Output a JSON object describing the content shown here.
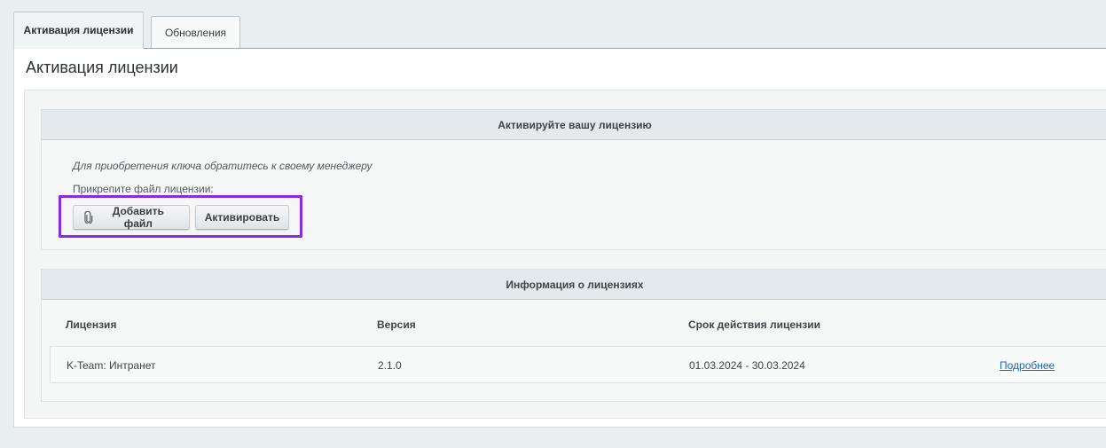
{
  "tabs": [
    {
      "label": "Активация лицензии",
      "active": true
    },
    {
      "label": "Обновления",
      "active": false
    }
  ],
  "page_title": "Активация лицензии",
  "activate_section": {
    "title": "Активируйте вашу лицензию",
    "hint": "Для приобретения ключа обратитесь к своему менеджеру",
    "attach_label": "Прикрепите файл лицензии:",
    "add_file_button": "Добавить файл",
    "activate_button": "Активировать",
    "highlight_color": "#8a2be2"
  },
  "license_section": {
    "title": "Информация о лицензиях",
    "columns": [
      "Лицензия",
      "Версия",
      "Срок действия лицензии"
    ],
    "rows": [
      {
        "license": "K-Team: Интранет",
        "version": "2.1.0",
        "period": "01.03.2024 - 30.03.2024",
        "details": "Подробнее"
      }
    ]
  },
  "colors": {
    "link": "#2067b0",
    "header_bg": "#e3e9ec"
  }
}
